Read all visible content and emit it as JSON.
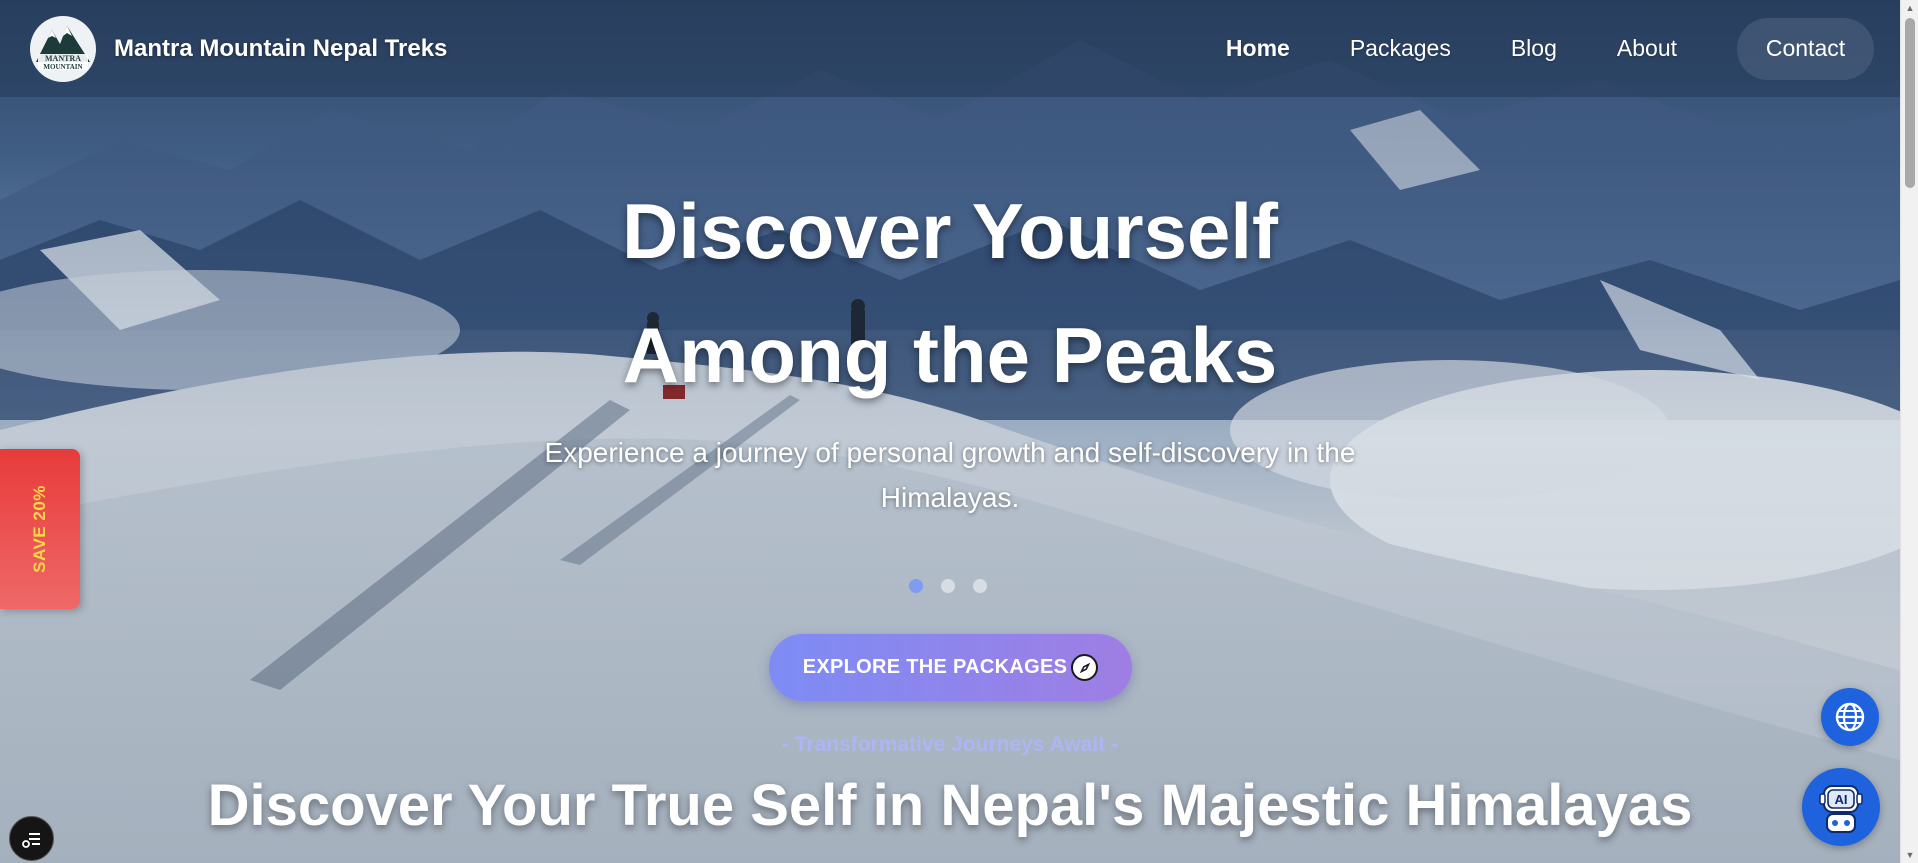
{
  "brand": {
    "name": "Mantra Mountain Nepal Treks",
    "logo_text": [
      "MANTRA",
      "MOUNTAIN"
    ]
  },
  "nav": {
    "items": [
      {
        "label": "Home",
        "active": true
      },
      {
        "label": "Packages",
        "active": false
      },
      {
        "label": "Blog",
        "active": false
      },
      {
        "label": "About",
        "active": false
      }
    ],
    "contact": "Contact"
  },
  "hero": {
    "title_line1": "Discover Yourself",
    "title_line2": "Among the Peaks",
    "subtitle": "Experience a journey of personal growth and self-discovery in the Himalayas.",
    "slides": 3,
    "active_slide": 1,
    "cta_label": "EXPLORE THE PACKAGES"
  },
  "section": {
    "eyebrow": "- Transformative Journeys Await -",
    "title": "Discover Your True Self in Nepal's Majestic Himalayas"
  },
  "promo": {
    "label": "SAVE 20%"
  },
  "floating": {
    "filter_icon": "filter-icon",
    "globe_icon": "globe-icon",
    "ai_label": "AI"
  },
  "colors": {
    "cta_start": "#7d8cf5",
    "cta_end": "#9f7ee3",
    "promo_red": "#e83b3b",
    "promo_text": "#ffd84a",
    "floating_blue": "#1e63dd",
    "eyebrow": "#aeb5f3"
  }
}
